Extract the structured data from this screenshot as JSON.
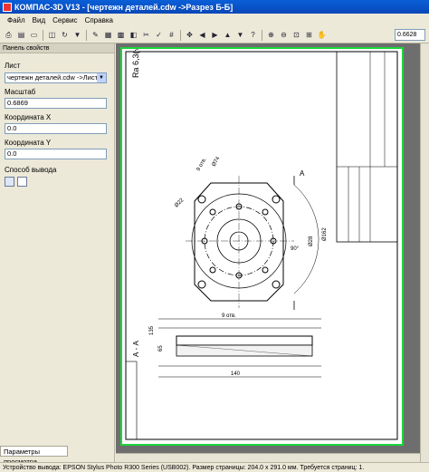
{
  "window": {
    "title": "КОМПАС-3D V13 - [чертежн деталей.cdw ->Разрез Б-Б]"
  },
  "menu": [
    "Файл",
    "Вид",
    "Сервис",
    "Справка"
  ],
  "toolbar": {
    "zoom": "0.6628"
  },
  "panel": {
    "title": "Панель свойств",
    "sheet_label": "Лист",
    "sheet_value": "чертежн деталей.cdw ->Лист :",
    "scale_label": "Масштаб",
    "scale_value": "0.6869",
    "x_label": "Координата X",
    "x_value": "0.0",
    "y_label": "Координата Y",
    "y_value": "0.0",
    "mode_label": "Способ вывода",
    "tab_label": "Параметры просмотра"
  },
  "drawing": {
    "roughness": "Ra 6,3(√)",
    "section_a": "А - А",
    "section_mark": "А",
    "dims": [
      "9 отв.",
      "Ø22",
      "Ø74",
      "R24",
      "Ø162",
      "Ø28",
      "90°",
      "9 отв.",
      "135",
      "65",
      "140"
    ]
  },
  "statusbar": {
    "text": "Устройство вывода: EPSON Stylus Photo R300 Series (USB002). Размер страницы: 204.0 x 291.0 мм. Требуется страниц: 1."
  }
}
